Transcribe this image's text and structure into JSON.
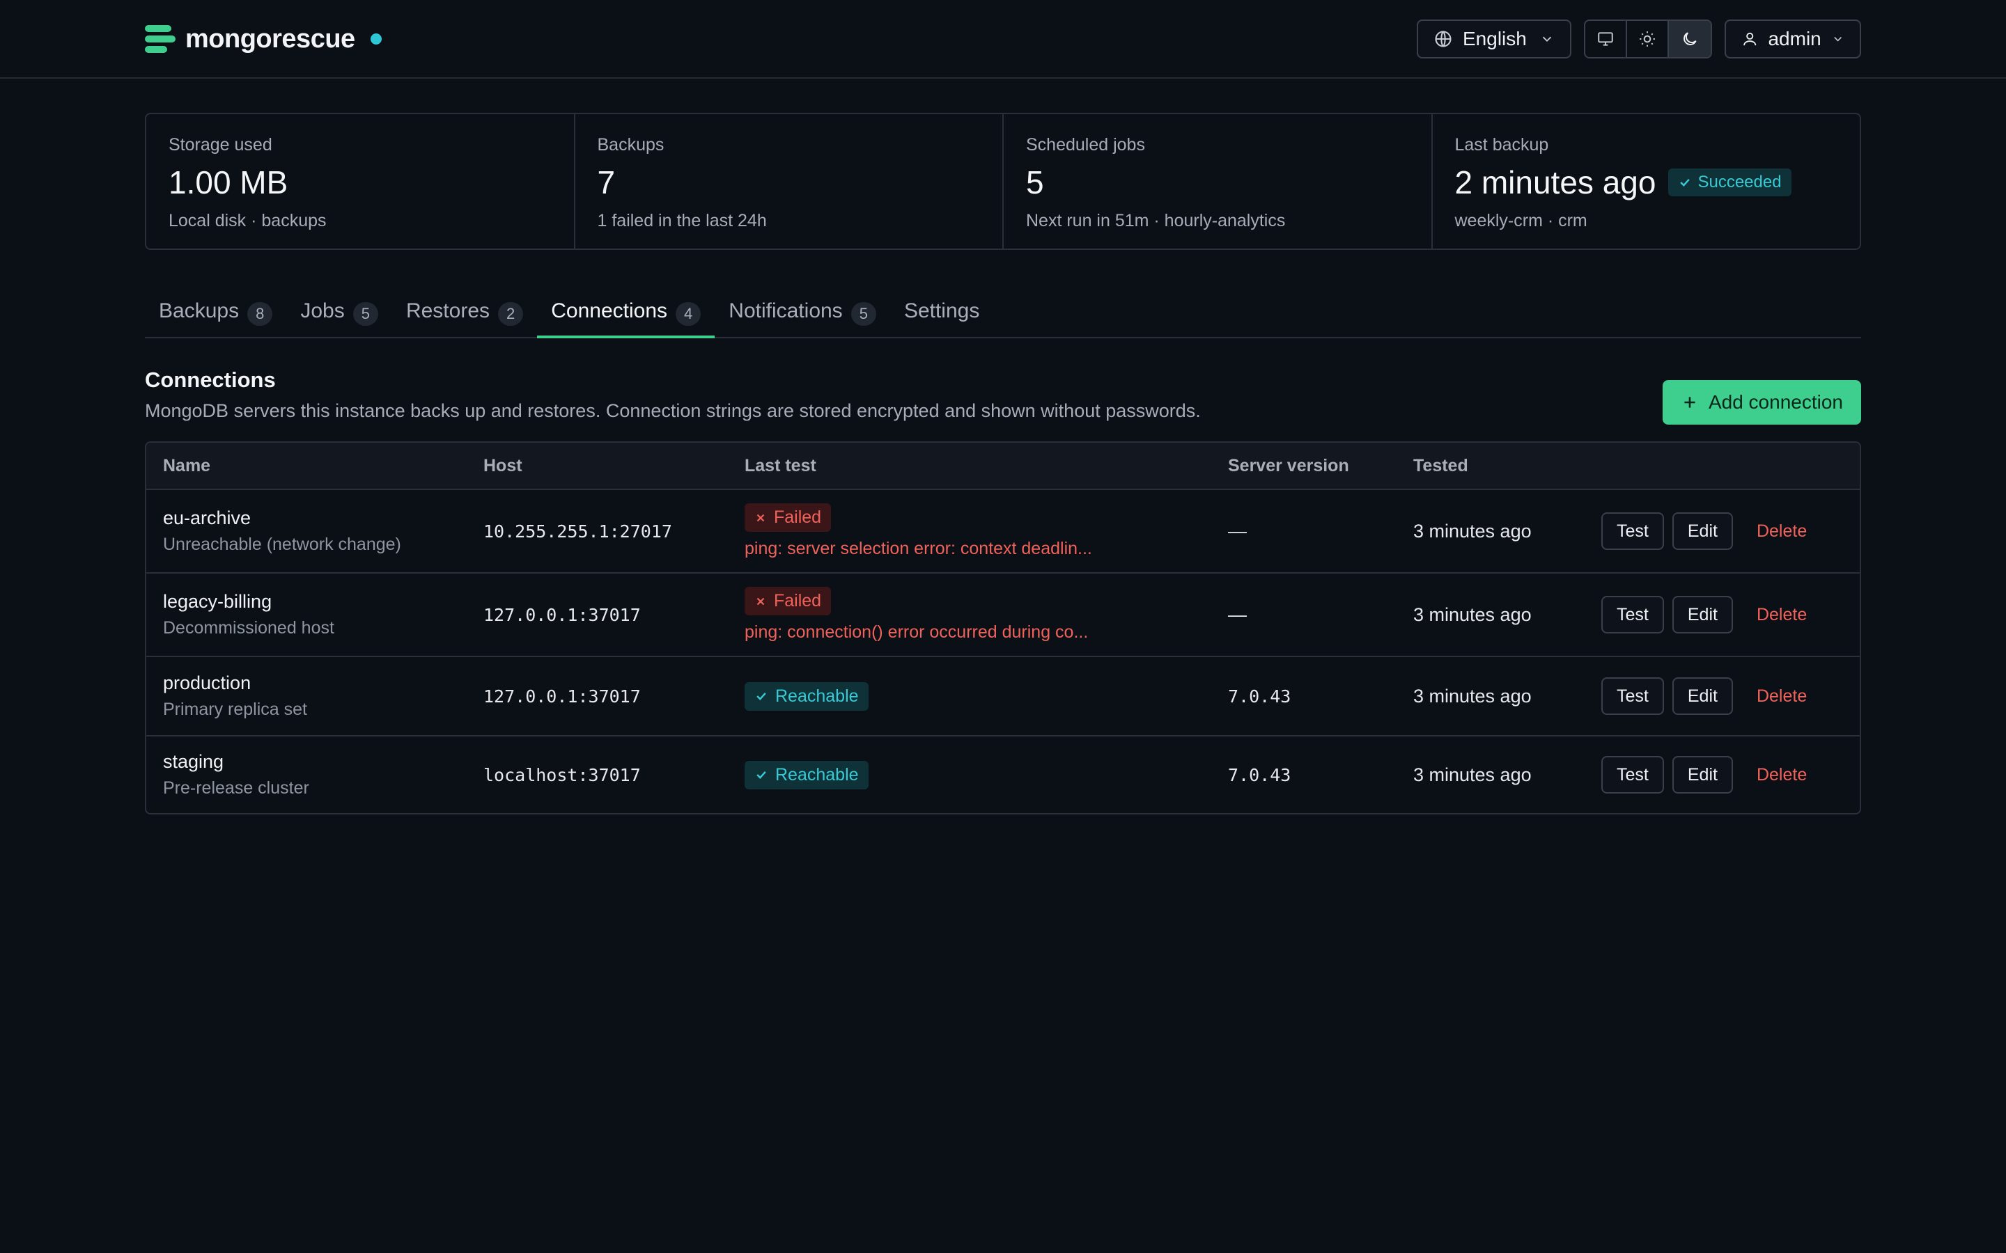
{
  "brand": {
    "name": "mongorescue"
  },
  "topbar": {
    "language": "English",
    "user": "admin"
  },
  "stats": [
    {
      "label": "Storage used",
      "value": "1.00 MB",
      "sub": "Local disk · backups"
    },
    {
      "label": "Backups",
      "value": "7",
      "sub": "1 failed in the last 24h"
    },
    {
      "label": "Scheduled jobs",
      "value": "5",
      "sub": "Next run in 51m · hourly-analytics"
    },
    {
      "label": "Last backup",
      "value": "2 minutes ago",
      "badge": "Succeeded",
      "sub": "weekly-crm · crm"
    }
  ],
  "tabs": [
    {
      "label": "Backups",
      "count": "8"
    },
    {
      "label": "Jobs",
      "count": "5"
    },
    {
      "label": "Restores",
      "count": "2"
    },
    {
      "label": "Connections",
      "count": "4"
    },
    {
      "label": "Notifications",
      "count": "5"
    },
    {
      "label": "Settings"
    }
  ],
  "section": {
    "title": "Connections",
    "description": "MongoDB servers this instance backs up and restores. Connection strings are stored encrypted and shown without passwords.",
    "add_label": "Add connection"
  },
  "table": {
    "headers": [
      "Name",
      "Host",
      "Last test",
      "Server version",
      "Tested"
    ],
    "actions": {
      "test": "Test",
      "edit": "Edit",
      "delete": "Delete"
    },
    "rows": [
      {
        "name": "eu-archive",
        "desc": "Unreachable (network change)",
        "host": "10.255.255.1:27017",
        "status": "Failed",
        "error": "ping: server selection error: context deadlin...",
        "version": "—",
        "tested": "3 minutes ago"
      },
      {
        "name": "legacy-billing",
        "desc": "Decommissioned host",
        "host": "127.0.0.1:37017",
        "status": "Failed",
        "error": "ping: connection() error occurred during co...",
        "version": "—",
        "tested": "3 minutes ago"
      },
      {
        "name": "production",
        "desc": "Primary replica set",
        "host": "127.0.0.1:37017",
        "status": "Reachable",
        "version": "7.0.43",
        "tested": "3 minutes ago"
      },
      {
        "name": "staging",
        "desc": "Pre-release cluster",
        "host": "localhost:37017",
        "status": "Reachable",
        "version": "7.0.43",
        "tested": "3 minutes ago"
      }
    ]
  },
  "colors": {
    "accent": "#3ecf8e",
    "teal": "#2dc7d6",
    "danger": "#f0625a",
    "background": "#0b0f16"
  }
}
